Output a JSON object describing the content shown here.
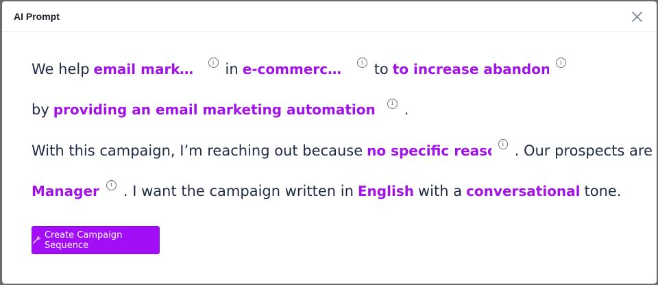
{
  "modal": {
    "title": "AI Prompt",
    "close_icon": "close-icon"
  },
  "prompt": {
    "line1": {
      "t1": "We help",
      "audience": "email marketi…",
      "t2": "in",
      "industry": "e-commerce a…",
      "t3": "to",
      "goal": "to increase abandoned c"
    },
    "line2": {
      "t1": "by",
      "solution": "providing an email marketing automation platform",
      "t2": "."
    },
    "line3": {
      "t1": "With this campaign, I’m reaching out because",
      "reason": "no specific reason",
      "t2": ". Our prospects are"
    },
    "line4": {
      "role": "Manager",
      "t1": ". I want the campaign written in",
      "language": "English",
      "t2": "with a",
      "tone": "conversational",
      "t3": "tone."
    }
  },
  "actions": {
    "create_label": "Create Campaign Sequence",
    "create_icon": "magic-wand-icon"
  },
  "colors": {
    "accent": "#a20ef5",
    "field_text": "#a214e6",
    "body_text": "#1f2a44"
  }
}
